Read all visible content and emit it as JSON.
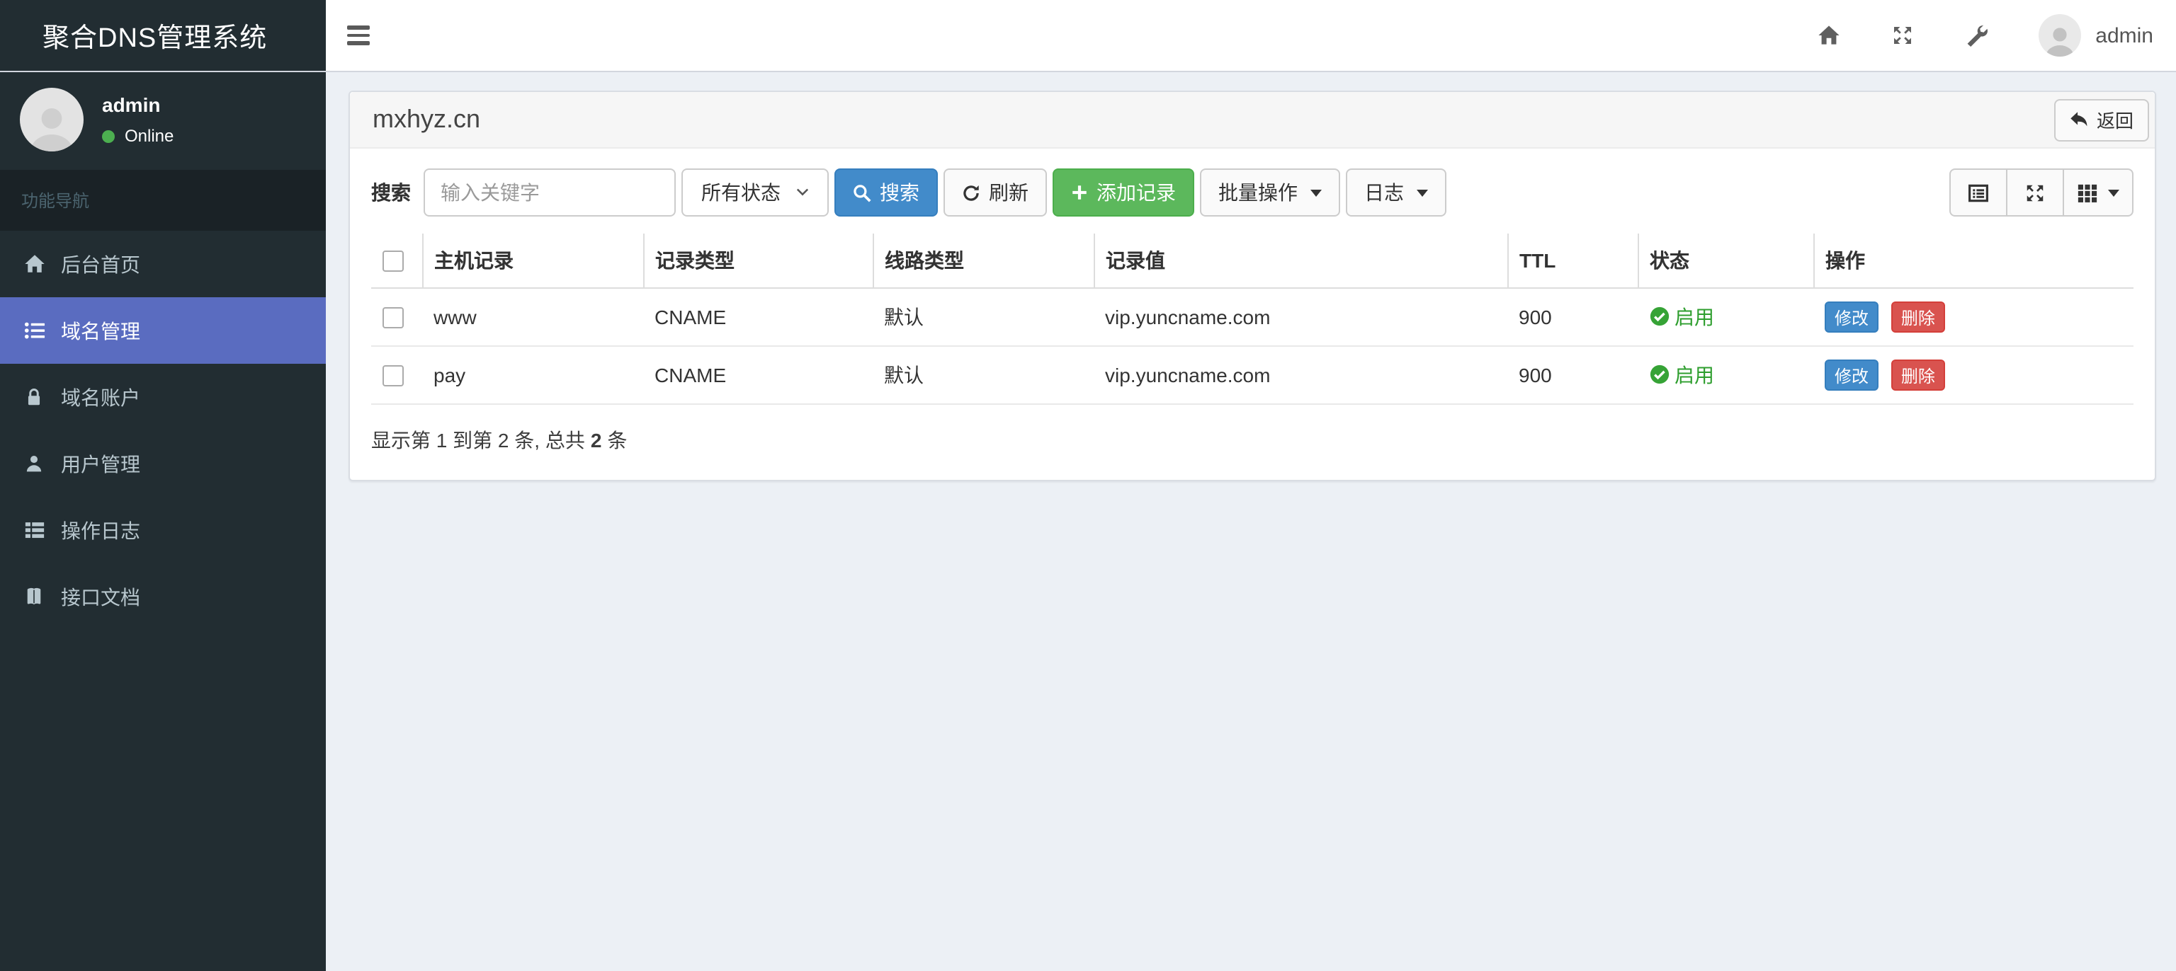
{
  "app": {
    "name": "聚合DNS管理系统"
  },
  "navbar": {
    "username": "admin",
    "icons": [
      "home-icon",
      "expand-icon",
      "wrench-icon",
      "user-avatar"
    ]
  },
  "sidebar": {
    "user": {
      "name": "admin",
      "status": "Online"
    },
    "section_title": "功能导航",
    "items": [
      {
        "label": "后台首页",
        "icon": "home-icon",
        "active": false
      },
      {
        "label": "域名管理",
        "icon": "list-icon",
        "active": true
      },
      {
        "label": "域名账户",
        "icon": "lock-icon",
        "active": false
      },
      {
        "label": "用户管理",
        "icon": "user-icon",
        "active": false
      },
      {
        "label": "操作日志",
        "icon": "th-list-icon",
        "active": false
      },
      {
        "label": "接口文档",
        "icon": "book-icon",
        "active": false
      }
    ]
  },
  "content": {
    "domain_title": "mxhyz.cn",
    "back_button": "返回",
    "toolbar": {
      "search_label": "搜索",
      "keyword_placeholder": "输入关键字",
      "status_filter": "所有状态",
      "search_button": "搜索",
      "refresh_button": "刷新",
      "add_record_button": "添加记录",
      "batch_button": "批量操作",
      "log_button": "日志",
      "right_icons": [
        "list-alt-icon",
        "expand-icon",
        "th-grid-icon"
      ]
    },
    "table": {
      "columns": [
        "主机记录",
        "记录类型",
        "线路类型",
        "记录值",
        "TTL",
        "状态",
        "操作"
      ],
      "rows": [
        {
          "host": "www",
          "type": "CNAME",
          "line": "默认",
          "value": "vip.yuncname.com",
          "ttl": "900",
          "status": "启用",
          "actions": [
            "修改",
            "删除"
          ]
        },
        {
          "host": "pay",
          "type": "CNAME",
          "line": "默认",
          "value": "vip.yuncname.com",
          "ttl": "900",
          "status": "启用",
          "actions": [
            "修改",
            "删除"
          ]
        }
      ]
    },
    "pagination": {
      "prefix": "显示第 1 到第 2 条, 总共",
      "total": "2",
      "suffix": "条"
    }
  },
  "colors": {
    "sidebar_bg": "#222d32",
    "sidebar_section_bg": "#1a2226",
    "sidebar_active": "#5a6cc0",
    "primary": "#428bca",
    "success": "#5cb85c",
    "danger": "#d9534f",
    "status_green": "#2e9e2e",
    "content_bg": "#ecf0f5"
  }
}
